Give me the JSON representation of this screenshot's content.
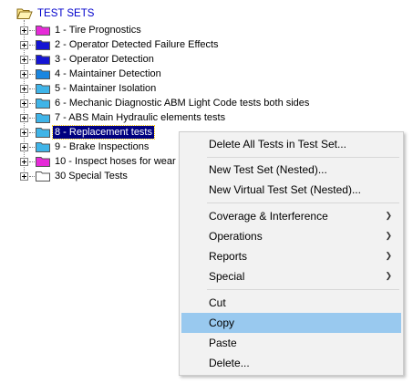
{
  "tree": {
    "root_label": "TEST SETS",
    "items": [
      {
        "label": "1 - Tire Prognostics",
        "folder_color": "#e62ad8"
      },
      {
        "label": "2 - Operator Detected Failure Effects",
        "folder_color": "#1515d4"
      },
      {
        "label": "3 - Operator Detection",
        "folder_color": "#1515d4"
      },
      {
        "label": "4 - Maintainer Detection",
        "folder_color": "#1a86e0"
      },
      {
        "label": "5 - Maintainer Isolation",
        "folder_color": "#3fb4e8"
      },
      {
        "label": "6 - Mechanic Diagnostic ABM Light Code tests both sides",
        "folder_color": "#3fb4e8"
      },
      {
        "label": "7 - ABS Main Hydraulic elements tests",
        "folder_color": "#3fb4e8"
      },
      {
        "label": "8 - Replacement tests",
        "folder_color": "#3fb4e8"
      },
      {
        "label": "9 - Brake Inspections",
        "folder_color": "#3fb4e8"
      },
      {
        "label": "10 - Inspect hoses for wear",
        "folder_color": "#e62ad8"
      },
      {
        "label": "30 Special Tests",
        "folder_color": "#ffffff"
      }
    ]
  },
  "context_menu": {
    "items": [
      {
        "label": "Delete All Tests in Test Set..."
      },
      {
        "label": "New Test Set (Nested)..."
      },
      {
        "label": "New Virtual Test Set (Nested)..."
      },
      {
        "label": "Coverage & Interference"
      },
      {
        "label": "Operations"
      },
      {
        "label": "Reports"
      },
      {
        "label": "Special"
      },
      {
        "label": "Cut"
      },
      {
        "label": "Copy"
      },
      {
        "label": "Paste"
      },
      {
        "label": "Delete..."
      }
    ],
    "submenu_arrow": "❯"
  }
}
